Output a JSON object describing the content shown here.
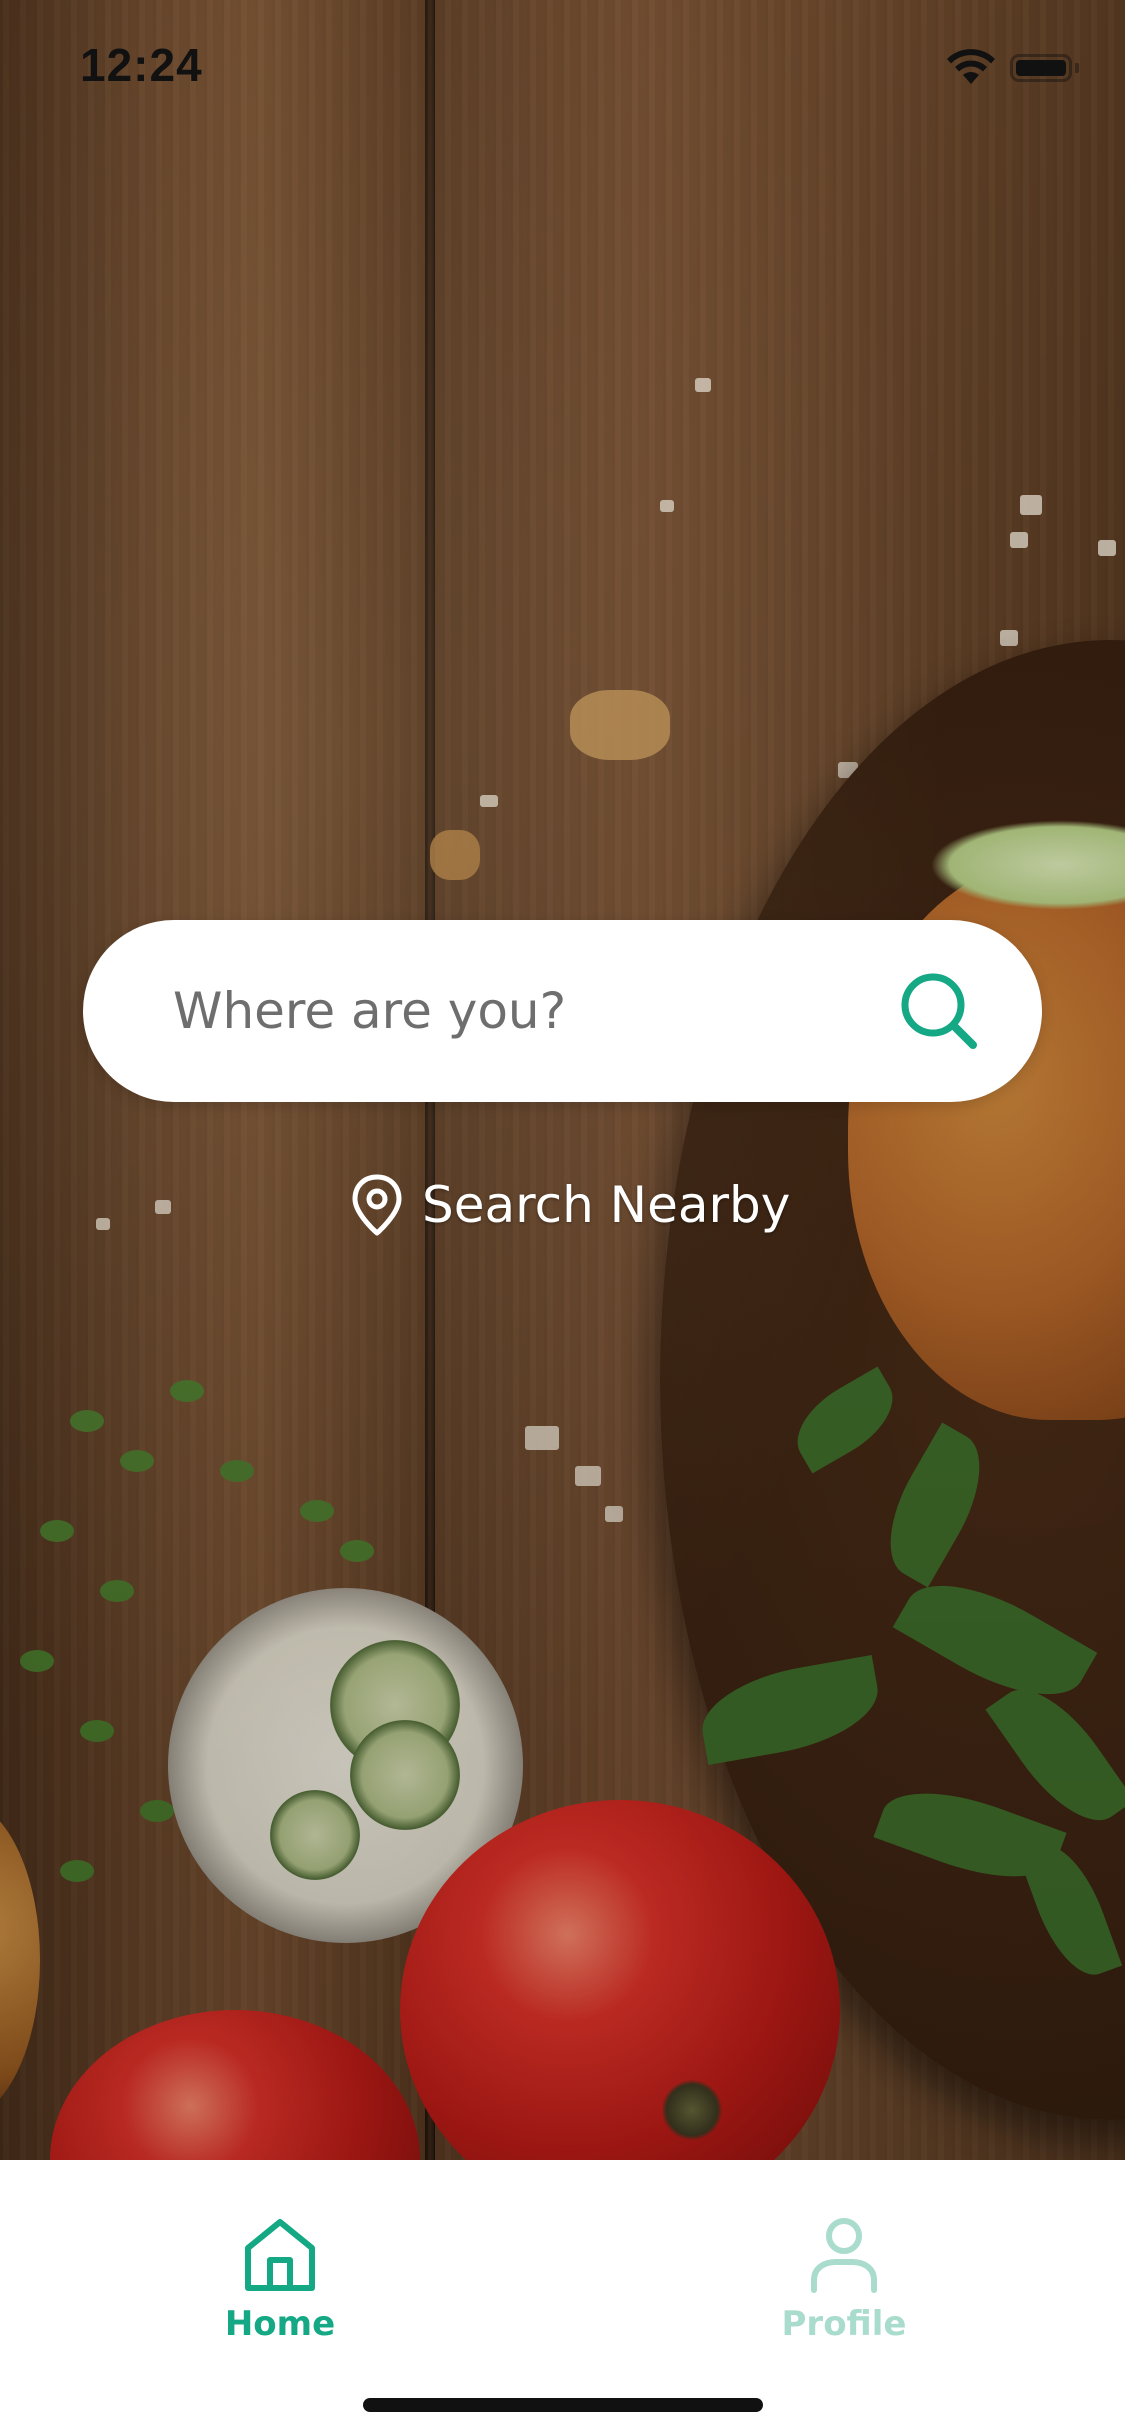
{
  "status_bar": {
    "time": "12:24",
    "icons": [
      "wifi-icon",
      "battery-icon"
    ]
  },
  "search": {
    "placeholder": "Where are you?",
    "value": "",
    "icon": "search-icon"
  },
  "nearby": {
    "icon": "location-pin-icon",
    "label": "Search Nearby"
  },
  "tab_bar": {
    "items": [
      {
        "label": "Home",
        "icon": "home-icon",
        "active": true
      },
      {
        "label": "Profile",
        "icon": "user-icon",
        "active": false
      }
    ]
  },
  "colors": {
    "accent": "#14a884",
    "inactive_tab": "#a9dccd",
    "search_bg": "#ffffff",
    "nearby_text": "#ffffff"
  }
}
